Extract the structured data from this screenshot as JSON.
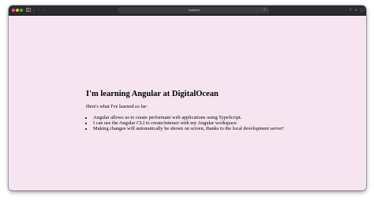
{
  "browser": {
    "address": "localhost",
    "controls": {
      "back_icon": "chevron-left-icon",
      "forward_icon": "chevron-right-icon",
      "share_icon": "share-icon",
      "new_tab_icon": "plus-icon",
      "tabs_icon": "tab-overview-icon"
    },
    "colors": {
      "titlebar": "#2b2a2e",
      "page_background": "#f6e5f0",
      "close": "#ff5f57",
      "minimize": "#febc2e",
      "maximize": "#28c840"
    }
  },
  "page": {
    "heading": "I'm learning Angular at DigitalOcean",
    "intro": "Here's what I've learned so far:",
    "items": [
      "Angular allows us to create performant web applications using TypeScript.",
      "I can use the Angular CLI to create/interact with my Angular workspace.",
      "Making changes will automatically be shown on screen, thanks to the local development server!"
    ]
  }
}
